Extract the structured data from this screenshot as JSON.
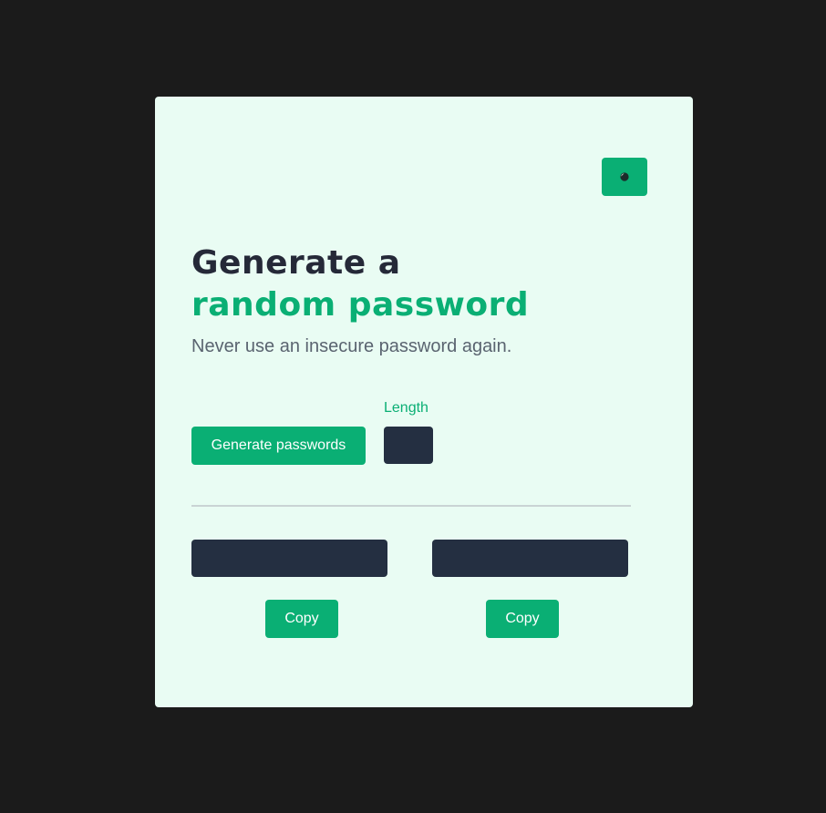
{
  "theme_toggle": {
    "icon": "half-circle-icon"
  },
  "headline": {
    "line1": "Generate a",
    "line2": "random password"
  },
  "subtitle": "Never use an insecure password again.",
  "controls": {
    "generate_label": "Generate passwords",
    "length_label": "Length",
    "length_value": ""
  },
  "outputs": [
    {
      "value": "",
      "copy_label": "Copy"
    },
    {
      "value": "",
      "copy_label": "Copy"
    }
  ],
  "colors": {
    "background": "#1b1b1b",
    "card": "#e9fcf3",
    "accent": "#0aaf74",
    "heading": "#252938",
    "input_bg": "#242f41",
    "subtitle": "#5a6470"
  }
}
